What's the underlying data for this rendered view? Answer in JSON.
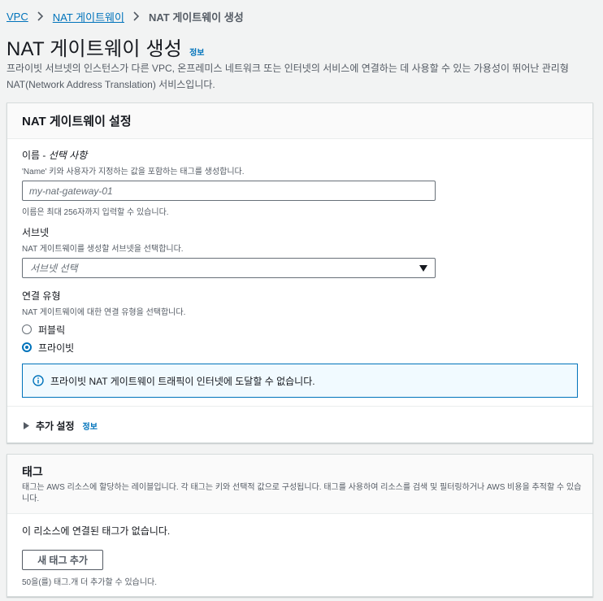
{
  "breadcrumb": {
    "items": [
      "VPC",
      "NAT 게이트웨이"
    ],
    "current": "NAT 게이트웨이 생성"
  },
  "page": {
    "title": "NAT 게이트웨이 생성",
    "info": "정보",
    "description": "프라이빗 서브넷의 인스턴스가 다른 VPC, 온프레미스 네트워크 또는 인터넷의 서비스에 연결하는 데 사용할 수 있는 가용성이 뛰어난 관리형 NAT(Network Address Translation) 서비스입니다."
  },
  "settings": {
    "title": "NAT 게이트웨이 설정",
    "name": {
      "label": "이름 - ",
      "label_optional": "선택 사항",
      "description": "'Name' 키와 사용자가 지정하는 값을 포함하는 태그를 생성합니다.",
      "placeholder": "my-nat-gateway-01",
      "constraint": "이름은 최대 256자까지 입력할 수 있습니다."
    },
    "subnet": {
      "label": "서브넷",
      "description": "NAT 게이트웨이를 생성할 서브넷을 선택합니다.",
      "placeholder": "서브넷 선택"
    },
    "connectivity": {
      "label": "연결 유형",
      "description": "NAT 게이트웨이에 대한 연결 유형을 선택합니다.",
      "options": [
        "퍼블릭",
        "프라이빗"
      ],
      "selected": "프라이빗"
    },
    "alert": "프라이빗 NAT 게이트웨이 트래픽이 인터넷에 도달할 수 없습니다.",
    "additional": {
      "label": "추가 설정",
      "info": "정보"
    }
  },
  "tags": {
    "title": "태그",
    "description": "태그는 AWS 리소스에 할당하는 레이블입니다. 각 태그는 키와 선택적 값으로 구성됩니다. 태그를 사용하여 리소스를 검색 및 필터링하거나 AWS 비용을 추적할 수 있습니다.",
    "empty": "이 리소스에 연결된 태그가 없습니다.",
    "add_button": "새 태그 추가",
    "limit": "50을(를) 태그.개 더 추가할 수 있습니다."
  },
  "colors": {
    "link": "#0073bb",
    "text": "#16191f",
    "muted": "#545b64",
    "background": "#f2f3f3",
    "alert_background": "#f1faff"
  }
}
